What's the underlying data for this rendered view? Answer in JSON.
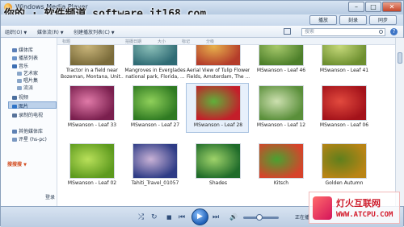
{
  "window": {
    "title": "Windows Media Player",
    "controls": [
      "–",
      "□",
      "✕"
    ]
  },
  "watermark_top": "你的 · 软件频道 software.it168.com",
  "tabs": [
    "播放",
    "刻录",
    "同步"
  ],
  "toolbar": {
    "organize": "组织(O)",
    "stream": "媒体流(R)",
    "create_playlist": "创建播放列表(C)",
    "search_placeholder": "搜索",
    "help": "?"
  },
  "sidebar": {
    "items": [
      {
        "label": "媒体库",
        "icon": "library-icon"
      },
      {
        "label": "播放列表",
        "icon": "playlist-icon"
      },
      {
        "label": "音乐",
        "icon": "music-icon"
      },
      {
        "label": "艺术家",
        "icon": "artist-icon"
      },
      {
        "label": "唱片集",
        "icon": "album-icon"
      },
      {
        "label": "流派",
        "icon": "genre-icon"
      },
      {
        "label": "视频",
        "icon": "video-icon"
      },
      {
        "label": "图片",
        "icon": "pictures-icon"
      },
      {
        "label": "录制的电视",
        "icon": "tv-icon"
      }
    ],
    "other_libraries": "其他媒体库",
    "other_item": "评星 (hs-pc)",
    "search_brand": "搜搜搜",
    "login": "登录"
  },
  "columns": [
    "标题",
    "拍摄日期",
    "大小",
    "标记",
    "分级"
  ],
  "tiles": [
    {
      "caption1": "Tractor in a field near",
      "caption2": "Bozeman, Montana, Unit...",
      "c1": "#7a6b3a",
      "c2": "#c9b57a"
    },
    {
      "caption1": "Mangroves in Everglades",
      "caption2": "national park, Florida, ...",
      "c1": "#2f6b74",
      "c2": "#8cc0b9"
    },
    {
      "caption1": "Aerial View of Tulip Flower",
      "caption2": "Fields, Amsterdam, The ...",
      "c1": "#b43c2a",
      "c2": "#e7b14c"
    },
    {
      "caption1": "MSwanson - Leaf 46",
      "caption2": "",
      "c1": "#4d7f2a",
      "c2": "#a7c96b"
    },
    {
      "caption1": "MSwanson - Leaf 41",
      "caption2": "",
      "c1": "#6d8f2f",
      "c2": "#c6d97a"
    },
    {
      "caption1": "MSwanson - Leaf 33",
      "caption2": "",
      "c1": "#7a1f4e",
      "c2": "#e07aa8"
    },
    {
      "caption1": "MSwanson - Leaf 27",
      "caption2": "",
      "c1": "#2f7a22",
      "c2": "#8fd05a"
    },
    {
      "caption1": "MSwanson - Leaf 28",
      "caption2": "",
      "c1": "#c41e2a",
      "c2": "#5fb03a"
    },
    {
      "caption1": "MSwanson - Leaf 12",
      "caption2": "",
      "c1": "#5a8f3a",
      "c2": "#cde0b0"
    },
    {
      "caption1": "MSwanson - Leaf 06",
      "caption2": "",
      "c1": "#a3121a",
      "c2": "#e24a3e"
    },
    {
      "caption1": "MSwanson - Leaf 02",
      "caption2": "",
      "c1": "#5d9a1e",
      "c2": "#b9e05a"
    },
    {
      "caption1": "Tahiti_Travel_01057",
      "caption2": "",
      "c1": "#2e3c86",
      "c2": "#c9b2d6"
    },
    {
      "caption1": "Shades",
      "caption2": "",
      "c1": "#1f6b2a",
      "c2": "#9fd36a"
    },
    {
      "caption1": "Kitsch",
      "caption2": "",
      "c1": "#d6432b",
      "c2": "#49a231"
    },
    {
      "caption1": "Golden Autumn",
      "caption2": "",
      "c1": "#b98415",
      "c2": "#5f7f1c"
    }
  ],
  "player": {
    "shuffle": "⤮",
    "repeat": "↻",
    "stop": "■",
    "prev": "⏮",
    "play": "▶",
    "next": "⏭",
    "mute": "🔊",
    "now_playing": "正在播"
  },
  "site_watermark": {
    "name": "灯火互联网",
    "url": "WWW.ATCPU.COM"
  }
}
